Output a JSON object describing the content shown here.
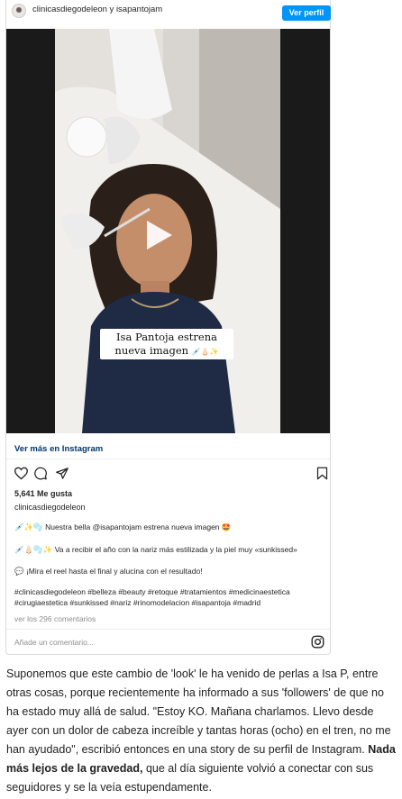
{
  "post": {
    "header": {
      "username": "clinicasdiegodeleon y isapantojam",
      "follow_label": "Ver perfil"
    },
    "media": {
      "overlay_caption": "Isa Pantoja estrena nueva imagen",
      "overlay_emoji": "💉👃🏻✨"
    },
    "view_more": "Ver más en Instagram",
    "likes": "5,641 Me gusta",
    "owner": "clinicasdiegodeleon",
    "caption_lines": [
      {
        "emoji": "💉✨🫧",
        "text": "Nuestra bella @isapantojam estrena nueva imagen 🤩"
      },
      {
        "emoji": "💉👃🏻🫧✨",
        "text": "Va a recibir el año con la nariz más estilizada y la piel muy «sunkissed»"
      },
      {
        "emoji": "💬",
        "text": "¡Mira el reel hasta el final y alucina con el resultado!"
      }
    ],
    "hashtags": "#clinicasdiegodeleon #belleza #beauty #retoque #tratamientos #medicinaestetica #cirugiaestetica #sunkissed #nariz #rinomodelacion #isapantoja #madrid",
    "comments_link": "ver los 296 comentarios",
    "add_comment_placeholder": "Añade un comentario..."
  },
  "article": {
    "para1": "Suponemos que este cambio de 'look' le ha venido de perlas a Isa P, entre otras cosas, porque recientemente ha informado a sus 'followers' de que no ha estado muy allá de salud. \"Estoy KO. Mañana charlamos. Llevo desde ayer con un dolor de cabeza increíble y tantas horas (ocho) en el tren, no me han ayudado\", escribió entonces en una story de su perfil de Instagram.",
    "bold_text": "Nada más lejos de la gravedad,",
    "para2": " que al día siguiente volvió a conectar con sus seguidores y se la veía estupendamente."
  },
  "colors": {
    "follow_button": "#0095f6",
    "link": "#00376b",
    "muted": "#8e8e8e"
  },
  "icons": [
    "heart-icon",
    "comment-icon",
    "share-icon",
    "bookmark-icon",
    "instagram-icon",
    "play-icon"
  ]
}
